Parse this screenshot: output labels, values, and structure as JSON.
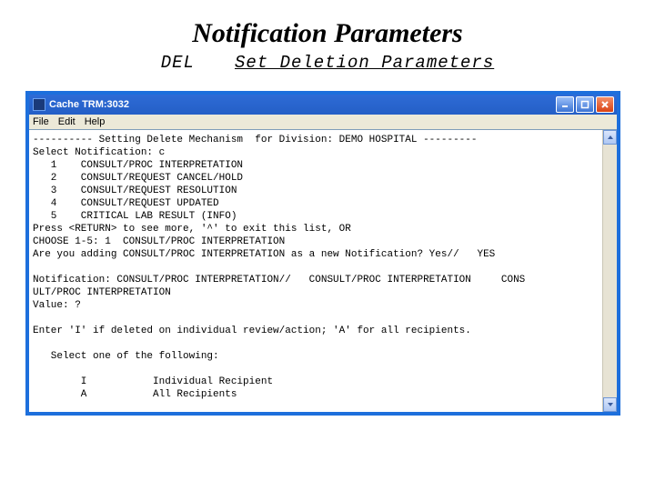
{
  "slide": {
    "title": "Notification Parameters",
    "subtitle_code": "DEL",
    "subtitle_text": "Set Deletion Parameters"
  },
  "window": {
    "title": "Cache TRM:3032",
    "menu": {
      "file": "File",
      "edit": "Edit",
      "help": "Help"
    }
  },
  "terminal": {
    "text": "---------- Setting Delete Mechanism  for Division: DEMO HOSPITAL ---------\nSelect Notification: c\n   1    CONSULT/PROC INTERPRETATION\n   2    CONSULT/REQUEST CANCEL/HOLD\n   3    CONSULT/REQUEST RESOLUTION\n   4    CONSULT/REQUEST UPDATED\n   5    CRITICAL LAB RESULT (INFO)\nPress <RETURN> to see more, '^' to exit this list, OR\nCHOOSE 1-5: 1  CONSULT/PROC INTERPRETATION\nAre you adding CONSULT/PROC INTERPRETATION as a new Notification? Yes//   YES\n\nNotification: CONSULT/PROC INTERPRETATION//   CONSULT/PROC INTERPRETATION     CONS\nULT/PROC INTERPRETATION\nValue: ?\n\nEnter 'I' if deleted on individual review/action; 'A' for all recipients.\n\n   Select one of the following:\n\n        I           Individual Recipient\n        A           All Recipients\n\nValue:"
  }
}
